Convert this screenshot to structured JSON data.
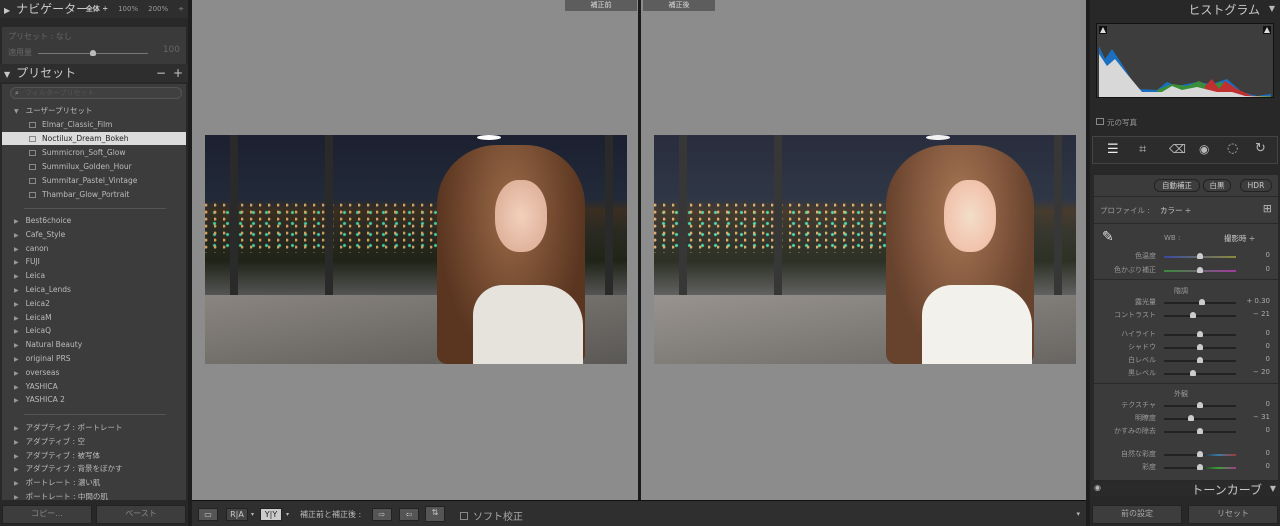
{
  "navigator": {
    "title": "ナビゲーター",
    "zoom_options": [
      "全体 ÷",
      "100%",
      "200%",
      "÷"
    ]
  },
  "preset_amount": {
    "label": "プリセット : なし",
    "amount_label": "適用量",
    "amount_value": "100",
    "amount_fraction": 0.5
  },
  "presets": {
    "title": "プリセット",
    "filter_placeholder": "フィルタープリセット",
    "user_group": "ユーザープリセット",
    "user_items": [
      "Elmar_Classic_Film",
      "Noctilux_Dream_Bokeh",
      "Summicron_Soft_Glow",
      "Summilux_Golden_Hour",
      "Summitar_Pastel_Vintage",
      "Thambar_Glow_Portrait"
    ],
    "selected": "Noctilux_Dream_Bokeh",
    "groups": [
      "Best6choice",
      "Cafe_Style",
      "canon",
      "FUJI",
      "Leica",
      "Leica_Lends",
      "Leica2",
      "LeicaM",
      "LeicaQ",
      "Natural Beauty",
      "original PRS",
      "overseas",
      "YASHICA",
      "YASHICA 2"
    ],
    "adaptive": [
      "アダプティブ : ポートレート",
      "アダプティブ : 空",
      "アダプティブ : 被写体",
      "アダプティブ : 背景をぼかす",
      "ポートレート : 濃い肌",
      "ポートレート : 中間の肌"
    ]
  },
  "left_buttons": {
    "copy": "コピー...",
    "paste": "ペースト"
  },
  "view": {
    "before_label": "補正前",
    "after_label": "補正後"
  },
  "toolbar": {
    "ra": "R|A",
    "yy": "Y|Y",
    "before_after_label": "補正前と補正後 :",
    "soft_proof": "ソフト校正",
    "soft_proof_checked": false
  },
  "histogram": {
    "title": "ヒストグラム",
    "original_photo": "元の写真"
  },
  "tools": [
    "edit-sliders",
    "crop",
    "heal",
    "red-eye",
    "mask",
    "reset-rotate"
  ],
  "basic": {
    "auto": "自動補正",
    "bw": "白黒",
    "hdr": "HDR",
    "profile_label": "プロファイル :",
    "profile_value": "カラー ÷",
    "wb_label": "WB :",
    "wb_value": "撮影時 ÷",
    "sliders_wb": [
      {
        "name": "色温度",
        "value": "0",
        "pos": 0.5
      },
      {
        "name": "色かぶり補正",
        "value": "0",
        "pos": 0.5
      }
    ],
    "tone_title": "階調",
    "sliders_tone": [
      {
        "name": "露光量",
        "value": "+ 0.30",
        "pos": 0.53
      },
      {
        "name": "コントラスト",
        "value": "− 21",
        "pos": 0.4
      }
    ],
    "sliders_tone2": [
      {
        "name": "ハイライト",
        "value": "0",
        "pos": 0.5
      },
      {
        "name": "シャドウ",
        "value": "0",
        "pos": 0.5
      },
      {
        "name": "白レベル",
        "value": "0",
        "pos": 0.5
      },
      {
        "name": "黒レベル",
        "value": "− 20",
        "pos": 0.4
      }
    ],
    "presence_title": "外観",
    "sliders_presence": [
      {
        "name": "テクスチャ",
        "value": "0",
        "pos": 0.5
      },
      {
        "name": "明瞭度",
        "value": "− 31",
        "pos": 0.37
      },
      {
        "name": "かすみの除去",
        "value": "0",
        "pos": 0.5
      }
    ],
    "sliders_color": [
      {
        "name": "自然な彩度",
        "value": "0",
        "pos": 0.5
      },
      {
        "name": "彩度",
        "value": "0",
        "pos": 0.5
      }
    ]
  },
  "tone_curve": {
    "title": "トーンカーブ"
  },
  "right_buttons": {
    "previous": "前の設定",
    "reset": "リセット"
  }
}
